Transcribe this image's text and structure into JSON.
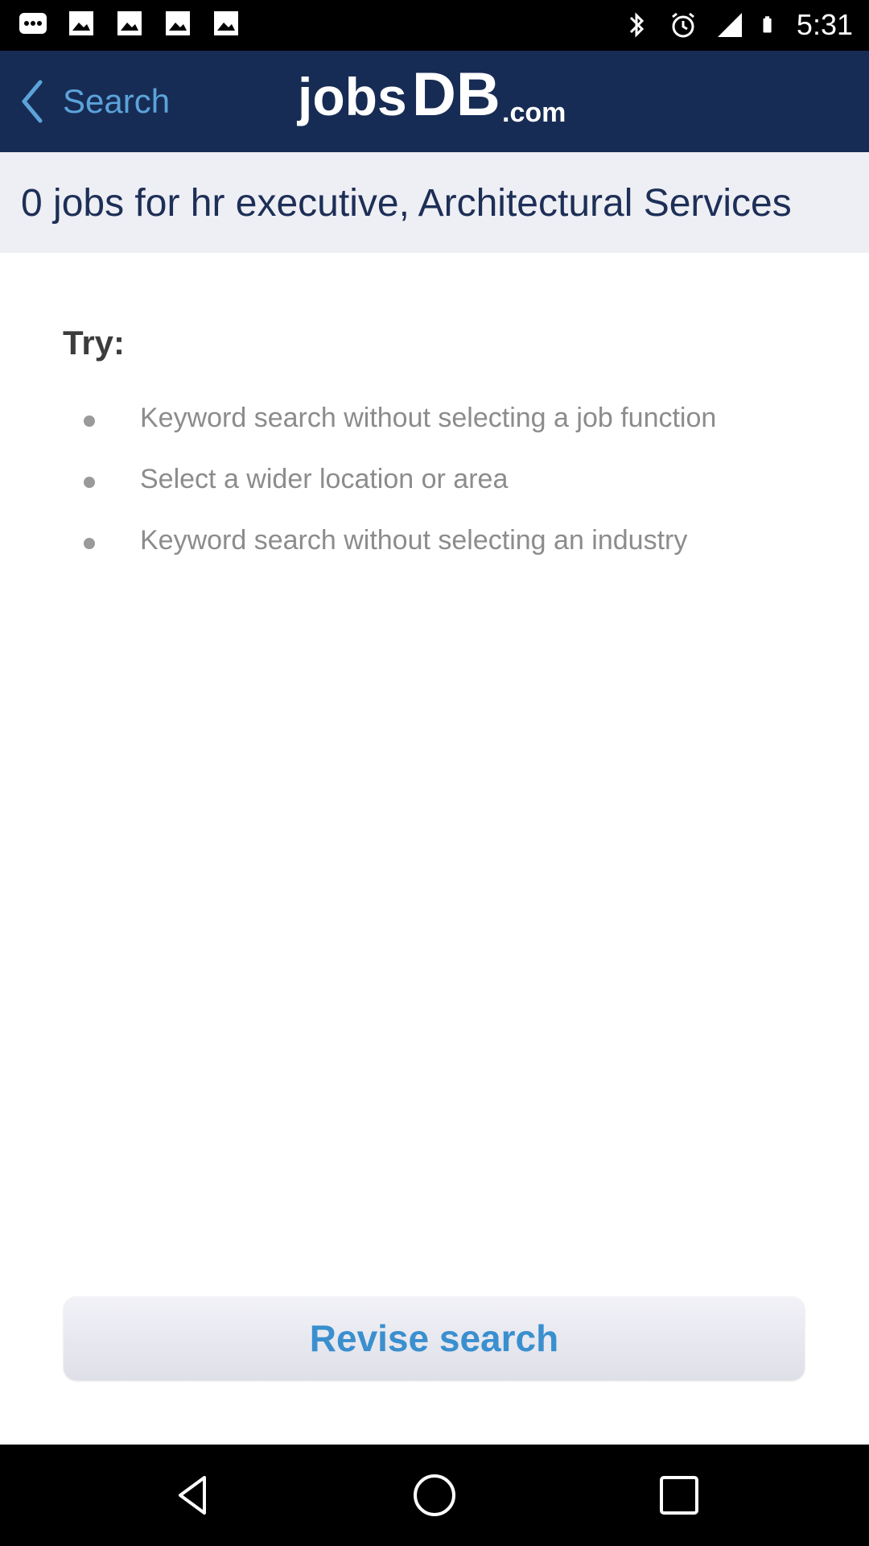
{
  "status_bar": {
    "time": "5:31",
    "left_icons": [
      "more-dots-icon",
      "image-icon",
      "image-icon",
      "image-icon",
      "image-icon"
    ],
    "right_icons": [
      "bluetooth-icon",
      "alarm-icon",
      "signal-icon",
      "battery-icon"
    ]
  },
  "app_bar": {
    "back_label": "Search",
    "logo_text": "jobsDB.com",
    "colors": {
      "background": "#172c54",
      "back_accent": "#5ba3da"
    }
  },
  "results": {
    "title": "0 jobs for hr executive, Architectural Services"
  },
  "try_section": {
    "heading": "Try:",
    "items": [
      "Keyword search without selecting a job function",
      "Select a wider location or area",
      "Keyword search without selecting an industry"
    ]
  },
  "revise_button": {
    "label": "Revise search",
    "accent": "#3a8fce"
  },
  "nav_bar": {
    "buttons": [
      "back-triangle-icon",
      "home-circle-icon",
      "recents-square-icon"
    ]
  }
}
